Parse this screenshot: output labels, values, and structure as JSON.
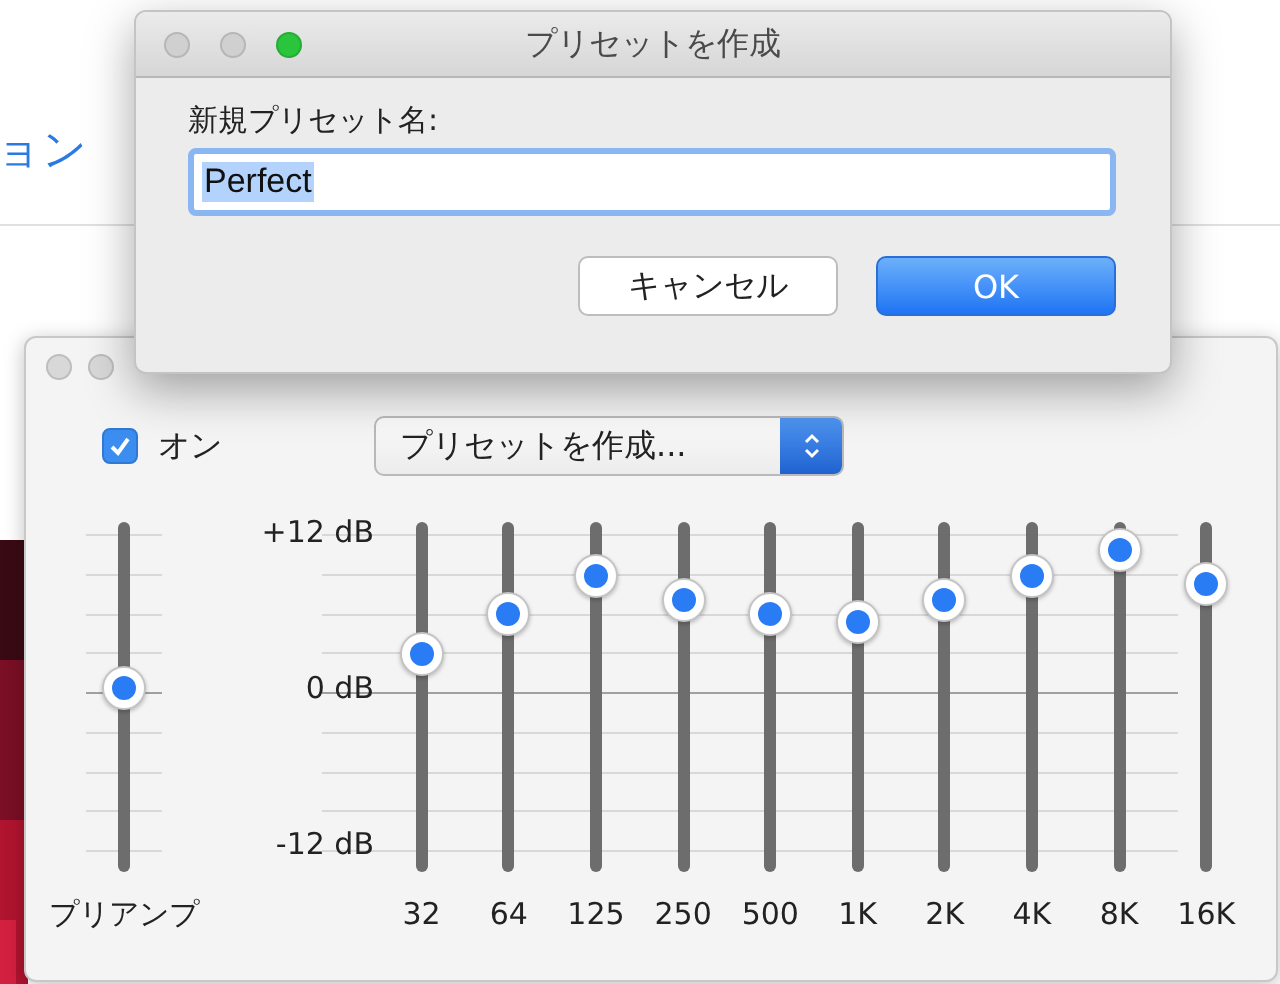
{
  "background": {
    "link_text": "ョン"
  },
  "equalizer": {
    "on_label": "オン",
    "on_checked": true,
    "preset": "プリセットを作成...",
    "scale": [
      "+12 dB",
      "0 dB",
      "-12 dB"
    ],
    "preamp": {
      "label": "プリアンプ",
      "level": 0.51
    },
    "bands": [
      {
        "label": "32",
        "level": 0.62
      },
      {
        "label": "64",
        "level": 0.75
      },
      {
        "label": "125",
        "level": 0.87
      },
      {
        "label": "250",
        "level": 0.79
      },
      {
        "label": "500",
        "level": 0.75
      },
      {
        "label": "1K",
        "level": 0.72
      },
      {
        "label": "2K",
        "level": 0.79
      },
      {
        "label": "4K",
        "level": 0.87
      },
      {
        "label": "8K",
        "level": 0.95
      },
      {
        "label": "16K",
        "level": 0.84
      }
    ]
  },
  "dialog": {
    "title": "プリセットを作成",
    "field_label": "新規プリセット名:",
    "field_value": "Perfect",
    "value_selected": true,
    "buttons": [
      {
        "label": "キャンセル",
        "kind": "secondary"
      },
      {
        "label": "OK",
        "kind": "default"
      }
    ]
  }
}
